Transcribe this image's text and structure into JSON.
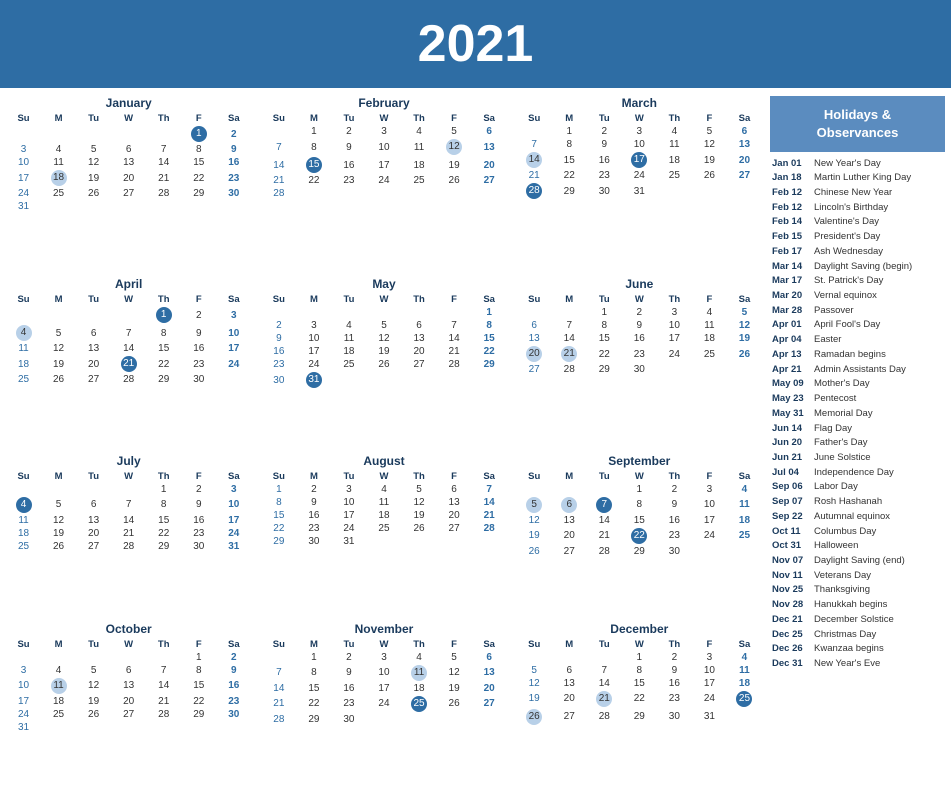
{
  "header": {
    "year": "2021"
  },
  "sidebar": {
    "title": "Holidays &\nObservances",
    "holidays": [
      {
        "date": "Jan 01",
        "name": "New Year's Day"
      },
      {
        "date": "Jan 18",
        "name": "Martin Luther King Day"
      },
      {
        "date": "Feb 12",
        "name": "Chinese New Year"
      },
      {
        "date": "Feb 12",
        "name": "Lincoln's Birthday"
      },
      {
        "date": "Feb 14",
        "name": "Valentine's Day"
      },
      {
        "date": "Feb 15",
        "name": "President's Day"
      },
      {
        "date": "Feb 17",
        "name": "Ash Wednesday"
      },
      {
        "date": "Mar 14",
        "name": "Daylight Saving (begin)"
      },
      {
        "date": "Mar 17",
        "name": "St. Patrick's Day"
      },
      {
        "date": "Mar 20",
        "name": "Vernal equinox"
      },
      {
        "date": "Mar 28",
        "name": "Passover"
      },
      {
        "date": "Apr 01",
        "name": "April Fool's Day"
      },
      {
        "date": "Apr 04",
        "name": "Easter"
      },
      {
        "date": "Apr 13",
        "name": "Ramadan begins"
      },
      {
        "date": "Apr 21",
        "name": "Admin Assistants Day"
      },
      {
        "date": "May 09",
        "name": "Mother's Day"
      },
      {
        "date": "May 23",
        "name": "Pentecost"
      },
      {
        "date": "May 31",
        "name": "Memorial Day"
      },
      {
        "date": "Jun 14",
        "name": "Flag Day"
      },
      {
        "date": "Jun 20",
        "name": "Father's Day"
      },
      {
        "date": "Jun 21",
        "name": "June Solstice"
      },
      {
        "date": "Jul 04",
        "name": "Independence Day"
      },
      {
        "date": "Sep 06",
        "name": "Labor Day"
      },
      {
        "date": "Sep 07",
        "name": "Rosh Hashanah"
      },
      {
        "date": "Sep 22",
        "name": "Autumnal equinox"
      },
      {
        "date": "Oct 11",
        "name": "Columbus Day"
      },
      {
        "date": "Oct 31",
        "name": "Halloween"
      },
      {
        "date": "Nov 07",
        "name": "Daylight Saving (end)"
      },
      {
        "date": "Nov 11",
        "name": "Veterans Day"
      },
      {
        "date": "Nov 25",
        "name": "Thanksgiving"
      },
      {
        "date": "Nov 28",
        "name": "Hanukkah begins"
      },
      {
        "date": "Dec 21",
        "name": "December Solstice"
      },
      {
        "date": "Dec 25",
        "name": "Christmas Day"
      },
      {
        "date": "Dec 26",
        "name": "Kwanzaa begins"
      },
      {
        "date": "Dec 31",
        "name": "New Year's Eve"
      }
    ]
  },
  "months": [
    {
      "name": "January",
      "weeks": [
        [
          "",
          "",
          "",
          "",
          "",
          "1",
          "2"
        ],
        [
          "3",
          "4",
          "5",
          "6",
          "7",
          "8",
          "9"
        ],
        [
          "10",
          "11",
          "12",
          "13",
          "14",
          "15",
          "16"
        ],
        [
          "17",
          "18",
          "19",
          "20",
          "21",
          "22",
          "23"
        ],
        [
          "24",
          "25",
          "26",
          "27",
          "28",
          "29",
          "30"
        ],
        [
          "31",
          "",
          "",
          "",
          "",
          "",
          ""
        ]
      ],
      "highlights": {
        "1": "holiday",
        "18": "highlight"
      }
    },
    {
      "name": "February",
      "weeks": [
        [
          "",
          "1",
          "2",
          "3",
          "4",
          "5",
          "6"
        ],
        [
          "7",
          "8",
          "9",
          "10",
          "11",
          "12",
          "13"
        ],
        [
          "14",
          "15",
          "16",
          "17",
          "18",
          "19",
          "20"
        ],
        [
          "21",
          "22",
          "23",
          "24",
          "25",
          "26",
          "27"
        ],
        [
          "28",
          "",
          "",
          "",
          "",
          "",
          ""
        ]
      ],
      "highlights": {
        "6": "sat",
        "12": "highlight",
        "13": "sat",
        "15": "holiday"
      }
    },
    {
      "name": "March",
      "weeks": [
        [
          "",
          "1",
          "2",
          "3",
          "4",
          "5",
          "6"
        ],
        [
          "7",
          "8",
          "9",
          "10",
          "11",
          "12",
          "13"
        ],
        [
          "14",
          "15",
          "16",
          "17",
          "18",
          "19",
          "20"
        ],
        [
          "21",
          "22",
          "23",
          "24",
          "25",
          "26",
          "27"
        ],
        [
          "28",
          "29",
          "30",
          "31",
          "",
          "",
          ""
        ]
      ],
      "highlights": {
        "6": "sat",
        "14": "highlight",
        "17": "holiday",
        "20": "sat",
        "28": "holiday"
      }
    },
    {
      "name": "April",
      "weeks": [
        [
          "",
          "",
          "",
          "",
          "1",
          "2",
          "3"
        ],
        [
          "4",
          "5",
          "6",
          "7",
          "8",
          "9",
          "10"
        ],
        [
          "11",
          "12",
          "13",
          "14",
          "15",
          "16",
          "17"
        ],
        [
          "18",
          "19",
          "20",
          "21",
          "22",
          "23",
          "24"
        ],
        [
          "25",
          "26",
          "27",
          "28",
          "29",
          "30",
          ""
        ]
      ],
      "highlights": {
        "1": "holiday",
        "4": "highlight",
        "10": "sat",
        "21": "holiday"
      }
    },
    {
      "name": "May",
      "weeks": [
        [
          "",
          "",
          "",
          "",
          "",
          "",
          "1"
        ],
        [
          "2",
          "3",
          "4",
          "5",
          "6",
          "7",
          "8"
        ],
        [
          "9",
          "10",
          "11",
          "12",
          "13",
          "14",
          "15"
        ],
        [
          "16",
          "17",
          "18",
          "19",
          "20",
          "21",
          "22"
        ],
        [
          "23",
          "24",
          "25",
          "26",
          "27",
          "28",
          "29"
        ],
        [
          "30",
          "31",
          "",
          "",
          "",
          "",
          ""
        ]
      ],
      "highlights": {
        "1": "sat",
        "8": "sat",
        "15": "sat",
        "22": "sat",
        "29": "sat",
        "31": "holiday"
      }
    },
    {
      "name": "June",
      "weeks": [
        [
          "",
          "",
          "1",
          "2",
          "3",
          "4",
          "5"
        ],
        [
          "6",
          "7",
          "8",
          "9",
          "10",
          "11",
          "12"
        ],
        [
          "13",
          "14",
          "15",
          "16",
          "17",
          "18",
          "19"
        ],
        [
          "20",
          "21",
          "22",
          "23",
          "24",
          "25",
          "26"
        ],
        [
          "27",
          "28",
          "29",
          "30",
          "",
          "",
          ""
        ]
      ],
      "highlights": {
        "5": "sat",
        "12": "sat",
        "19": "sat",
        "20": "highlight",
        "21": "highlight",
        "26": "sat"
      }
    },
    {
      "name": "July",
      "weeks": [
        [
          "",
          "",
          "",
          "",
          "1",
          "2",
          "3"
        ],
        [
          "4",
          "5",
          "6",
          "7",
          "8",
          "9",
          "10"
        ],
        [
          "11",
          "12",
          "13",
          "14",
          "15",
          "16",
          "17"
        ],
        [
          "18",
          "19",
          "20",
          "21",
          "22",
          "23",
          "24"
        ],
        [
          "25",
          "26",
          "27",
          "28",
          "29",
          "30",
          "31"
        ]
      ],
      "highlights": {
        "3": "sat",
        "4": "holiday",
        "10": "sat",
        "17": "sat",
        "24": "sat",
        "31": "sat"
      }
    },
    {
      "name": "August",
      "weeks": [
        [
          "1",
          "2",
          "3",
          "4",
          "5",
          "6",
          "7"
        ],
        [
          "8",
          "9",
          "10",
          "11",
          "12",
          "13",
          "14"
        ],
        [
          "15",
          "16",
          "17",
          "18",
          "19",
          "20",
          "21"
        ],
        [
          "22",
          "23",
          "24",
          "25",
          "26",
          "27",
          "28"
        ],
        [
          "29",
          "30",
          "31",
          "",
          "",
          "",
          ""
        ]
      ],
      "highlights": {
        "7": "sat",
        "14": "sat",
        "21": "sat",
        "28": "sat"
      }
    },
    {
      "name": "September",
      "weeks": [
        [
          "",
          "",
          "",
          "1",
          "2",
          "3",
          "4"
        ],
        [
          "5",
          "6",
          "7",
          "8",
          "9",
          "10",
          "11"
        ],
        [
          "12",
          "13",
          "14",
          "15",
          "16",
          "17",
          "18"
        ],
        [
          "19",
          "20",
          "21",
          "22",
          "23",
          "24",
          "25"
        ],
        [
          "26",
          "27",
          "28",
          "29",
          "30",
          "",
          ""
        ]
      ],
      "highlights": {
        "4": "sat",
        "5": "highlight",
        "6": "highlight",
        "7": "holiday",
        "11": "sat",
        "18": "sat",
        "22": "holiday",
        "25": "sat"
      }
    },
    {
      "name": "October",
      "weeks": [
        [
          "",
          "",
          "",
          "",
          "",
          "1",
          "2"
        ],
        [
          "3",
          "4",
          "5",
          "6",
          "7",
          "8",
          "9"
        ],
        [
          "10",
          "11",
          "12",
          "13",
          "14",
          "15",
          "16"
        ],
        [
          "17",
          "18",
          "19",
          "20",
          "21",
          "22",
          "23"
        ],
        [
          "24",
          "25",
          "26",
          "27",
          "28",
          "29",
          "30"
        ],
        [
          "31",
          "",
          "",
          "",
          "",
          "",
          ""
        ]
      ],
      "highlights": {
        "2": "sat",
        "9": "sat",
        "11": "highlight",
        "16": "sat",
        "23": "sat",
        "30": "sat"
      }
    },
    {
      "name": "November",
      "weeks": [
        [
          "",
          "1",
          "2",
          "3",
          "4",
          "5",
          "6"
        ],
        [
          "7",
          "8",
          "9",
          "10",
          "11",
          "12",
          "13"
        ],
        [
          "14",
          "15",
          "16",
          "17",
          "18",
          "19",
          "20"
        ],
        [
          "21",
          "22",
          "23",
          "24",
          "25",
          "26",
          "27"
        ],
        [
          "28",
          "29",
          "30",
          "",
          "",
          "",
          ""
        ]
      ],
      "highlights": {
        "6": "sat",
        "11": "highlight",
        "13": "sat",
        "20": "sat",
        "25": "holiday",
        "27": "sat"
      }
    },
    {
      "name": "December",
      "weeks": [
        [
          "",
          "",
          "",
          "1",
          "2",
          "3",
          "4"
        ],
        [
          "5",
          "6",
          "7",
          "8",
          "9",
          "10",
          "11"
        ],
        [
          "12",
          "13",
          "14",
          "15",
          "16",
          "17",
          "18"
        ],
        [
          "19",
          "20",
          "21",
          "22",
          "23",
          "24",
          "25"
        ],
        [
          "26",
          "27",
          "28",
          "29",
          "30",
          "31",
          ""
        ]
      ],
      "highlights": {
        "4": "sat",
        "11": "sat",
        "18": "sat",
        "21": "highlight",
        "25": "holiday",
        "26": "highlight",
        "31": "sat"
      }
    }
  ]
}
